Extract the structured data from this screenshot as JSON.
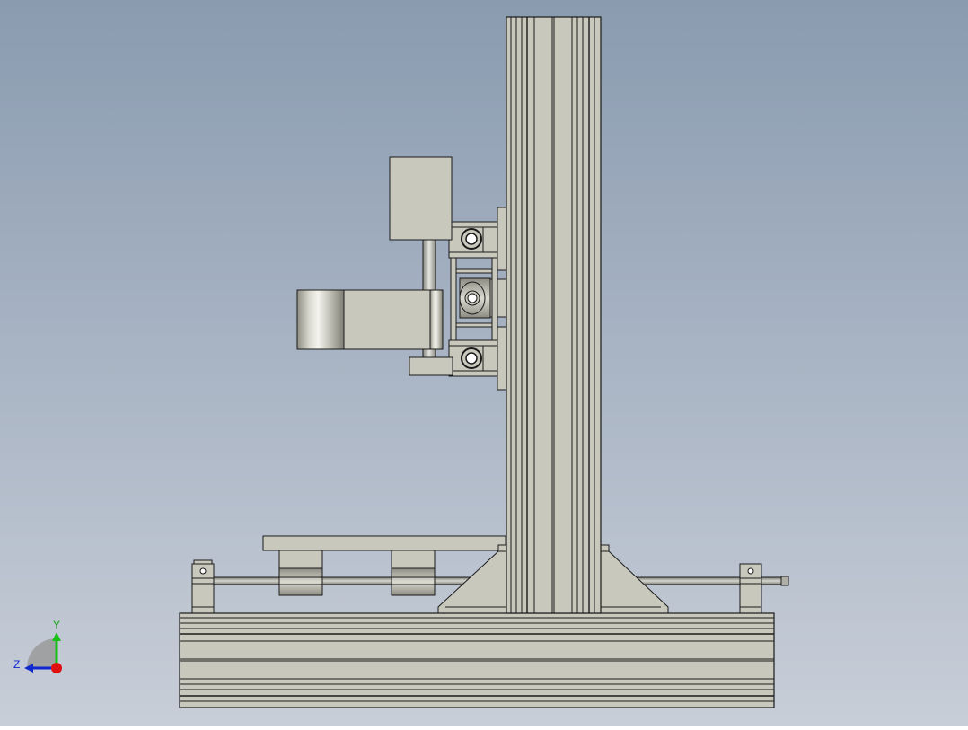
{
  "viewport": {
    "background_top": "#8a9bb0",
    "background_bottom": "#c8ced8"
  },
  "model": {
    "part_fill": "#c9c8bd",
    "part_fill_dark": "#b9b8ac",
    "edge_color": "#1a1a1a",
    "shaft_color": "#a8a8a0"
  },
  "triad": {
    "y_label": "Y",
    "z_label": "Z",
    "x_color": "#e01010",
    "y_color": "#18c018",
    "z_color": "#1028d0"
  }
}
